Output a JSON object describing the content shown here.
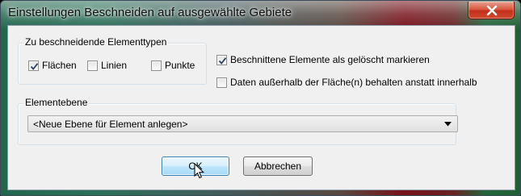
{
  "window": {
    "title": "Einstellungen Beschneiden auf ausgewählte Gebiete",
    "close_icon": "close-x-icon"
  },
  "element_types": {
    "label": "Zu beschneidende Elementtypen",
    "items": [
      {
        "label": "Flächen",
        "checked": true
      },
      {
        "label": "Linien",
        "checked": false
      },
      {
        "label": "Punkte",
        "checked": false
      }
    ]
  },
  "options": {
    "mark_deleted": {
      "label": "Beschnittene Elemente als gelöscht markieren",
      "checked": true
    },
    "keep_outside": {
      "label": "Daten außerhalb der Fläche(n) behalten anstatt innerhalb",
      "checked": false
    }
  },
  "element_layer": {
    "label": "Elementebene",
    "selected": "<Neue Ebene für Element anlegen>"
  },
  "buttons": {
    "ok": "OK",
    "cancel": "Abbrechen"
  },
  "colors": {
    "dialog_bg": "#f0f0f0",
    "close_red": "#c2301b",
    "default_button": "#bee6fd"
  }
}
